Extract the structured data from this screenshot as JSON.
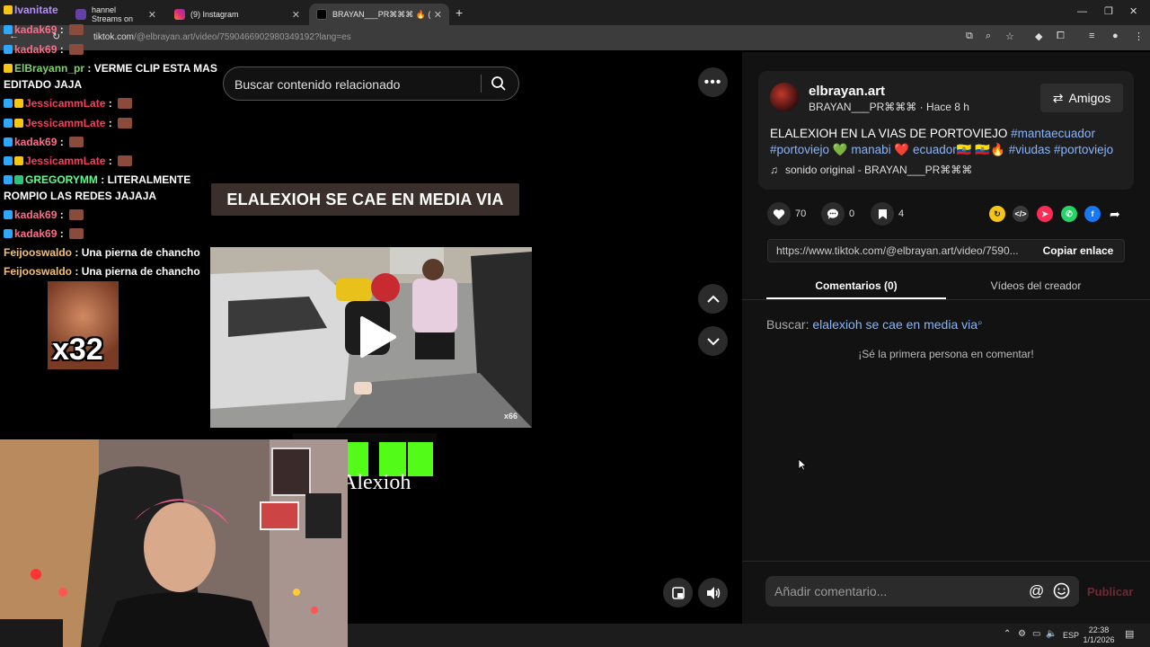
{
  "browser": {
    "tabs": [
      {
        "title": "hannel Streams on",
        "active": false
      },
      {
        "title": "(9) Instagram",
        "active": false
      },
      {
        "title": "BRAYAN___PR⌘⌘⌘ 🔥 (@elbray",
        "active": true
      }
    ],
    "url_domain": "tiktok.com",
    "url_path": "/@elbrayan.art/video/7590466902980349192?lang=es"
  },
  "tiktok": {
    "search_placeholder": "Buscar contenido relacionado",
    "video_caption": "ELALEXIOH SE CAE EN MEDIA VIA",
    "watermark": "x66",
    "subscribe_text": "Alexioh",
    "author": {
      "username": "elbrayan.art",
      "nickname": "BRAYAN___PR⌘⌘⌘",
      "time": "Hace 8 h",
      "friends_label": "Amigos"
    },
    "description": {
      "text": "ELALEXIOH EN LA VIAS DE PORTOVIEJO",
      "tags": [
        "#mantaecuador",
        "#portoviejo",
        "💚 manabi",
        "❤️ ecuador🇪🇨",
        "🇪🇨🔥",
        "#viudas",
        "#portoviejo"
      ]
    },
    "sound": "sonido original - BRAYAN___PR⌘⌘⌘",
    "stats": {
      "likes": "70",
      "comments": "0",
      "saves": "4"
    },
    "link": "https://www.tiktok.com/@elbrayan.art/video/7590...",
    "copy_label": "Copiar enlace",
    "tab_comments": "Comentarios (0)",
    "tab_videos": "Vídeos del creador",
    "search_related_label": "Buscar:",
    "search_related_query": "elalexioh se cae en media via",
    "first_comment": "¡Sé la primera persona en comentar!",
    "comment_placeholder": "Añadir comentario...",
    "publish_label": "Publicar"
  },
  "chat": {
    "messages": [
      {
        "user": "Ivanitate",
        "color": "#b48cff",
        "text": ""
      },
      {
        "user": "kadak69",
        "color": "#ff6b8a",
        "text": ""
      },
      {
        "user": "kadak69",
        "color": "#ff6b8a",
        "text": ""
      },
      {
        "user": "ElBrayann_pr",
        "color": "#7fd36b",
        "text": "VERME CLIP ESTA MAS"
      },
      {
        "user": "",
        "color": "#ffffff",
        "text": "EDITADO JAJA"
      },
      {
        "user": "JessicammLate",
        "color": "#ff3b5c",
        "text": ""
      },
      {
        "user": "JessicammLate",
        "color": "#ff3b5c",
        "text": ""
      },
      {
        "user": "kadak69",
        "color": "#ff6b8a",
        "text": ""
      },
      {
        "user": "JessicammLate",
        "color": "#ff3b5c",
        "text": ""
      },
      {
        "user": "GREGORYMM",
        "color": "#5cff8a",
        "text": "LITERALMENTE"
      },
      {
        "user": "",
        "color": "#ffffff",
        "text": "ROMPIO LAS REDES JAJAJA"
      },
      {
        "user": "kadak69",
        "color": "#ff6b8a",
        "text": ""
      },
      {
        "user": "kadak69",
        "color": "#ff6b8a",
        "text": ""
      },
      {
        "user": "Feijooswaldo",
        "color": "#f5c26b",
        "text": "Una pierna de chancho"
      },
      {
        "user": "Feijooswaldo",
        "color": "#f5c26b",
        "text": "Una pierna de chancho"
      }
    ],
    "emote_count": "x32"
  },
  "taskbar": {
    "lang": "ESP",
    "time": "22:38",
    "date": "1/1/2026"
  }
}
